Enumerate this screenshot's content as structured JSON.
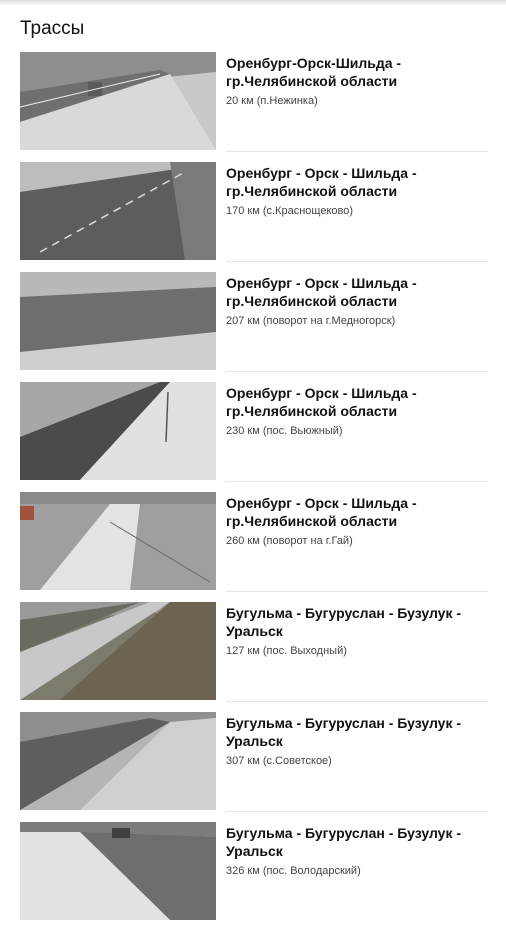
{
  "page": {
    "title": "Трассы"
  },
  "cameras": [
    {
      "title": "Оренбург-Орск-Шильда - гр.Челябинской области",
      "km": "20 км (п.Нежинка)",
      "scene": "a"
    },
    {
      "title": "Оренбург - Орск - Шильда - гр.Челябинской области",
      "km": "170 км (с.Краснощеково)",
      "scene": "b"
    },
    {
      "title": "Оренбург - Орск - Шильда - гр.Челябинской области",
      "km": "207 км (поворот на г.Медногорск)",
      "scene": "c"
    },
    {
      "title": "Оренбург - Орск - Шильда - гр.Челябинской области",
      "km": "230 км (пос. Вьюжный)",
      "scene": "d"
    },
    {
      "title": "Оренбург - Орск - Шильда - гр.Челябинской области",
      "km": "260 км (поворот на г.Гай)",
      "scene": "e"
    },
    {
      "title": "Бугульма - Бугуруслан - Бузулук - Уральск",
      "km": "127 км (пос. Выходный)",
      "scene": "f"
    },
    {
      "title": "Бугульма - Бугуруслан - Бузулук - Уральск",
      "km": "307 км (с.Советское)",
      "scene": "g"
    },
    {
      "title": "Бугульма - Бугуруслан - Бузулук - Уральск",
      "km": "326 км (пос. Володарский)",
      "scene": "h"
    }
  ]
}
